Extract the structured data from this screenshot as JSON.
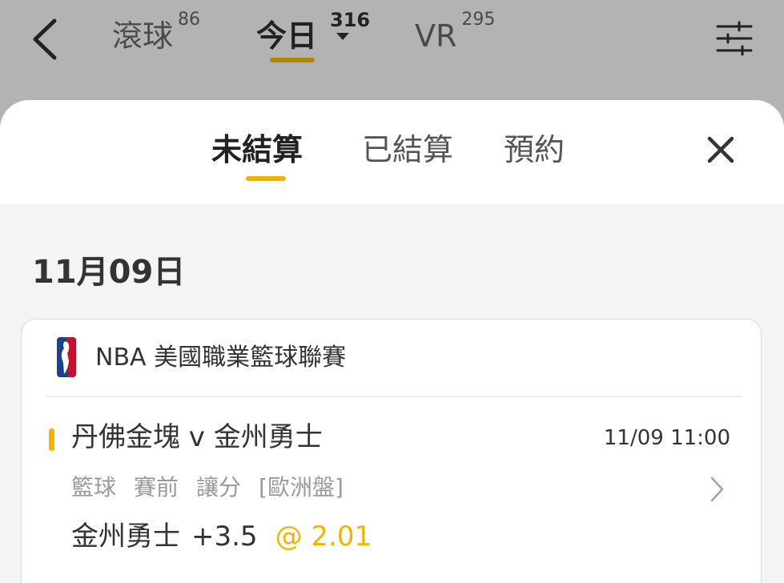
{
  "topnav": {
    "tabs": [
      {
        "label": "滾球",
        "count": "86"
      },
      {
        "label": "今日",
        "count": "316"
      },
      {
        "label": "VR",
        "count": "295"
      }
    ],
    "back_icon": "chevron-left-icon",
    "filter_icon": "sliders-icon"
  },
  "sheet": {
    "tabs": [
      {
        "label": "未結算"
      },
      {
        "label": "已結算"
      },
      {
        "label": "預約"
      }
    ],
    "close_icon": "close-icon",
    "accent_color": "#f2b400"
  },
  "date_heading": "11月09日",
  "bet": {
    "league": "NBA 美國職業籃球聯賽",
    "league_icon": "nba-logo-icon",
    "match": "丹佛金塊 v 金州勇士",
    "time": "11/09 11:00",
    "sport": "籃球",
    "phase": "賽前",
    "market": "讓分",
    "odds_type": "[歐洲盤]",
    "selection_team": "金州勇士",
    "handicap": "+3.5",
    "odds": "@ 2.01"
  }
}
